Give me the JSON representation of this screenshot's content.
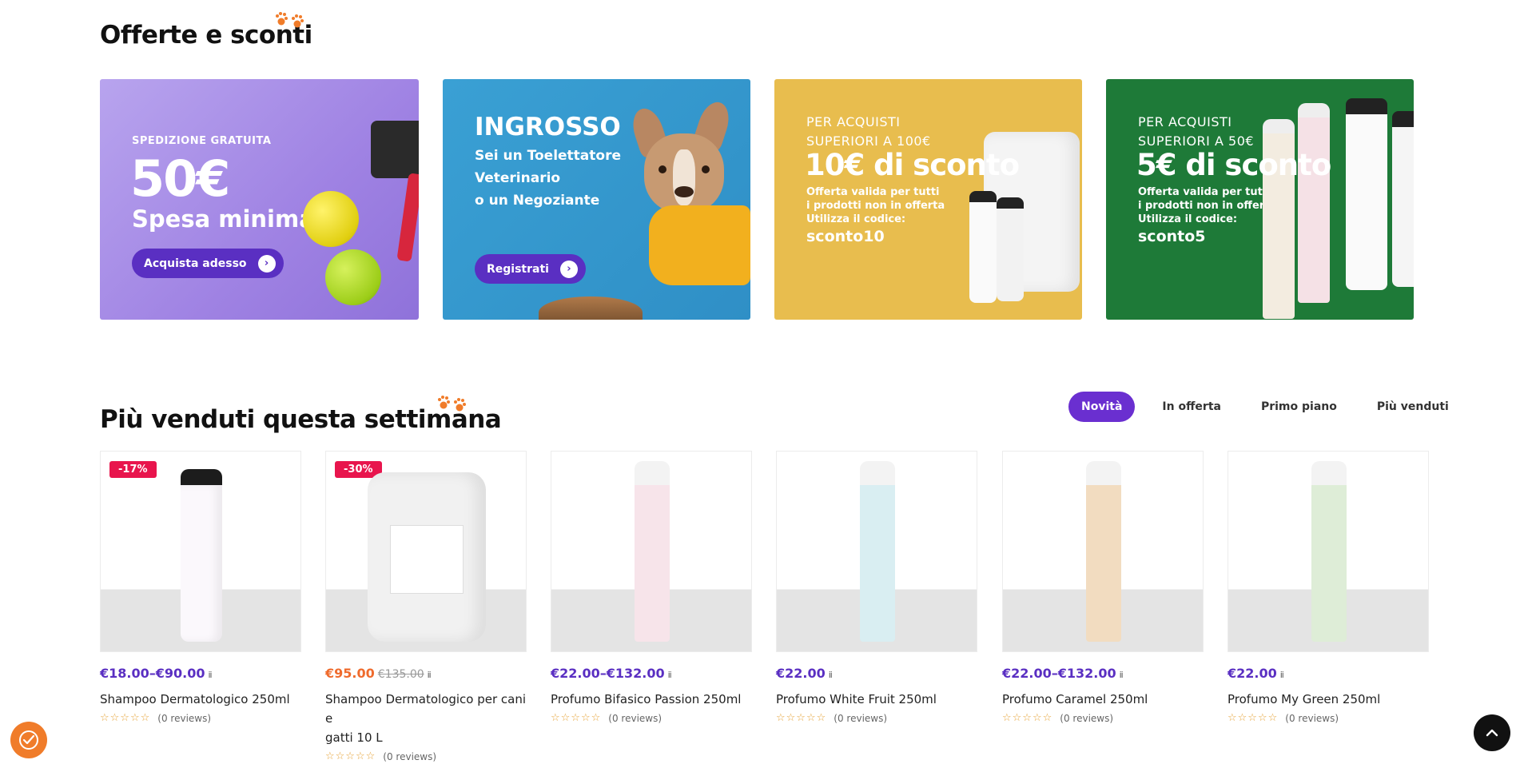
{
  "offers": {
    "title": "Offerte e sconti",
    "banners": [
      {
        "kicker": "SPEDIZIONE GRATUITA",
        "big": "50€",
        "sub": "Spesa minima",
        "button": "Acquista adesso"
      },
      {
        "title": "INGROSSO",
        "lines": [
          "Sei un Toelettatore",
          "Veterinario",
          "o un Negoziante"
        ],
        "button": "Registrati"
      },
      {
        "kicker1": "PER ACQUISTI",
        "kicker2": "SUPERIORI A 100€",
        "big": "10€ di sconto",
        "lines": [
          "Offerta valida per tutti",
          "i prodotti non in offerta",
          "Utilizza il codice:"
        ],
        "code": "sconto10"
      },
      {
        "kicker1": "PER ACQUISTI",
        "kicker2": "SUPERIORI A 50€",
        "big": "5€ di sconto",
        "lines": [
          "Offerta valida per tutti",
          "i prodotti non in offerta",
          "Utilizza il codice:"
        ],
        "code": "sconto5"
      }
    ]
  },
  "bestsellers": {
    "title": "Più venduti questa settimana",
    "tabs": [
      "Novità",
      "In offerta",
      "Primo piano",
      "Più venduti"
    ],
    "products": [
      {
        "badge": "-17%",
        "price": "€18.00–€90.00",
        "old_price": "",
        "name": "Shampoo Dermatologico 250ml",
        "name2": "",
        "reviews": "(0 reviews)",
        "bottle_color": "#e9d8ee"
      },
      {
        "badge": "-30%",
        "price": "€95.00",
        "old_price": "€135.00",
        "name": "Shampoo Dermatologico per cani e",
        "name2": "gatti 10 L",
        "reviews": "(0 reviews)",
        "bottle_color": "#e9e9e9"
      },
      {
        "badge": "",
        "price": "€22.00–€132.00",
        "old_price": "",
        "name": "Profumo Bifasico Passion 250ml",
        "name2": "",
        "reviews": "(0 reviews)",
        "bottle_color": "#f5dfe6"
      },
      {
        "badge": "",
        "price": "€22.00",
        "old_price": "",
        "name": "Profumo White Fruit 250ml",
        "name2": "",
        "reviews": "(0 reviews)",
        "bottle_color": "#d7ecf0"
      },
      {
        "badge": "",
        "price": "€22.00–€132.00",
        "old_price": "",
        "name": "Profumo Caramel 250ml",
        "name2": "",
        "reviews": "(0 reviews)",
        "bottle_color": "#f1dcc0"
      },
      {
        "badge": "",
        "price": "€22.00",
        "old_price": "",
        "name": "Profumo My Green 250ml",
        "name2": "",
        "reviews": "(0 reviews)",
        "bottle_color": "#dcecd6"
      }
    ],
    "stars": "☆☆☆☆☆",
    "info_icon": "ⅱ"
  },
  "colors": {
    "accent": "#5a2fc2",
    "sale": "#e8154d",
    "paw": "#f07c2a"
  }
}
